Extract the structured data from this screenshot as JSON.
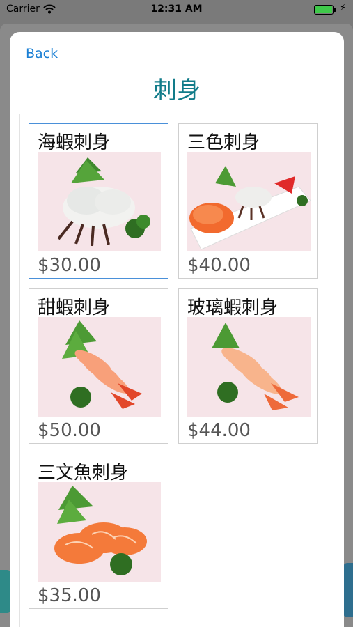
{
  "status_bar": {
    "carrier": "Carrier",
    "time": "12:31 AM"
  },
  "nav": {
    "back_label": "Back",
    "title": "刺身"
  },
  "items": [
    {
      "name": "海蝦刺身",
      "price": "$30.00",
      "image": "raw-shrimp-sashimi"
    },
    {
      "name": "三色刺身",
      "price": "$40.00",
      "image": "three-color-sashimi-platter"
    },
    {
      "name": "甜蝦刺身",
      "price": "$50.00",
      "image": "sweet-shrimp-sashimi"
    },
    {
      "name": "玻璃蝦刺身",
      "price": "$44.00",
      "image": "glass-shrimp-sashimi"
    },
    {
      "name": "三文魚刺身",
      "price": "$35.00",
      "image": "salmon-sashimi"
    }
  ],
  "colors": {
    "title": "#127c8a",
    "link": "#1a7fd4",
    "selected_border": "#4a90d9",
    "image_bg": "#f6e4e8"
  }
}
